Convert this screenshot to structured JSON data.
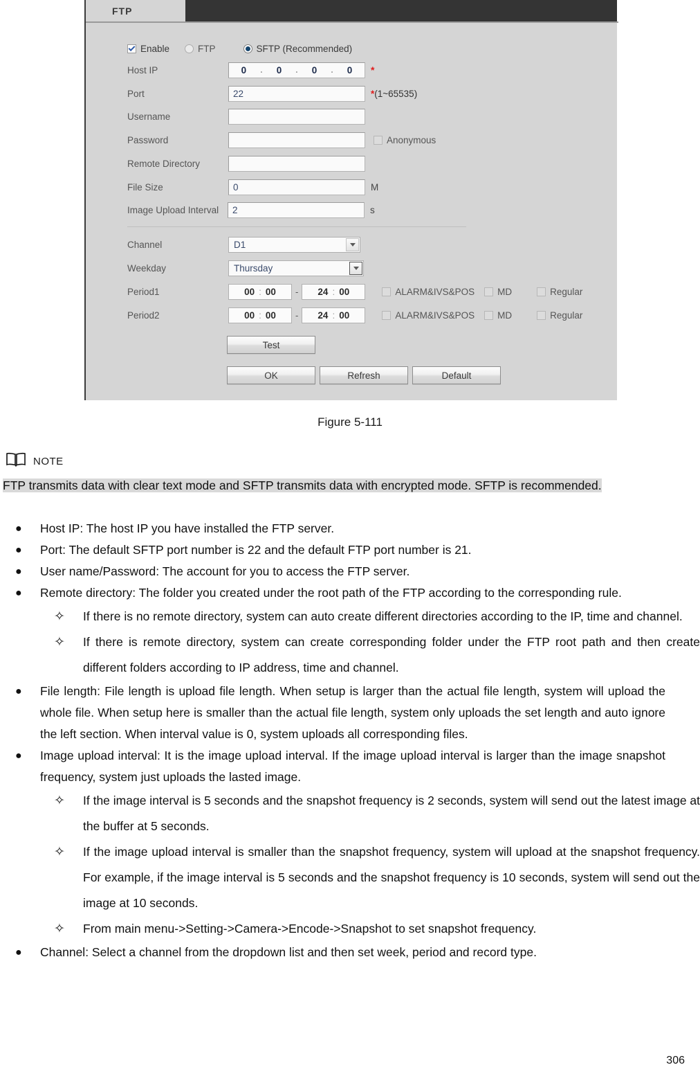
{
  "panel": {
    "tab_label": "FTP",
    "enable": {
      "label": "Enable",
      "checked": true
    },
    "protocol": {
      "ftp_label": "FTP",
      "sftp_label": "SFTP (Recommended)",
      "selected": "SFTP (Recommended)"
    },
    "fields": {
      "host_ip": {
        "label": "Host IP",
        "octets": [
          "0",
          "0",
          "0",
          "0"
        ],
        "required_mark": "*"
      },
      "port": {
        "label": "Port",
        "value": "22",
        "required_mark": "*",
        "range_hint": "(1~65535)"
      },
      "username": {
        "label": "Username",
        "value": "",
        "placeholder": ""
      },
      "password": {
        "label": "Password",
        "value": "",
        "placeholder": ""
      },
      "anonymous": {
        "label": "Anonymous",
        "checked": false
      },
      "remote_directory": {
        "label": "Remote Directory",
        "value": "",
        "placeholder": ""
      },
      "file_size": {
        "label": "File Size",
        "value": "0",
        "unit": "M"
      },
      "image_upload_interval": {
        "label": "Image Upload Interval",
        "value": "2",
        "unit": "s"
      },
      "channel": {
        "label": "Channel",
        "value": "D1"
      },
      "weekday": {
        "label": "Weekday",
        "value": "Thursday"
      }
    },
    "periods": [
      {
        "label": "Period1",
        "start_hour": "00",
        "start_min": "00",
        "end_hour": "24",
        "end_min": "00",
        "separator": "-",
        "types": [
          {
            "label": "ALARM&IVS&POS",
            "checked": false
          },
          {
            "label": "MD",
            "checked": false
          },
          {
            "label": "Regular",
            "checked": false
          }
        ]
      },
      {
        "label": "Period2",
        "start_hour": "00",
        "start_min": "00",
        "end_hour": "24",
        "end_min": "00",
        "separator": "-",
        "types": [
          {
            "label": "ALARM&IVS&POS",
            "checked": false
          },
          {
            "label": "MD",
            "checked": false
          },
          {
            "label": "Regular",
            "checked": false
          }
        ]
      }
    ],
    "buttons": {
      "test": "Test",
      "ok": "OK",
      "refresh": "Refresh",
      "default": "Default"
    },
    "colors": {
      "panel_bg": "#d5d5d5",
      "tabbar_bg": "#343434",
      "required_star": "#e01b1b",
      "radio_selected": "#15456e",
      "check_mark": "#2e5aa8"
    }
  },
  "doc": {
    "figure_caption": "Figure 5-111",
    "note_label": "NOTE",
    "note_text": "FTP transmits data with clear text mode and SFTP transmits data with encrypted mode. SFTP is recommended.",
    "bullets": [
      {
        "level": 1,
        "marker": "●",
        "text": "Host IP: The host IP you have installed the FTP server."
      },
      {
        "level": 1,
        "marker": "●",
        "text": "Port: The default SFTP port number is 22 and the default FTP port number is 21."
      },
      {
        "level": 1,
        "marker": "●",
        "text": "User name/Password: The account for you to access the FTP server."
      },
      {
        "level": 1,
        "marker": "●",
        "text": "Remote directory: The folder you created under the root path of the FTP according to the corresponding rule."
      },
      {
        "level": 2,
        "marker": "✧",
        "text": "If there is no remote directory, system can auto create different directories according to the IP, time and channel."
      },
      {
        "level": 2,
        "marker": "✧",
        "text": "If there is remote directory, system can create corresponding folder under the FTP root path and then create different folders according to IP address, time and channel."
      },
      {
        "level": 1,
        "marker": "●",
        "text": "File length: File length is upload file length. When setup is larger than the actual file length, system will upload the whole file. When setup here is smaller than the actual file length, system only uploads the set length and auto ignore the left section. When interval value is 0, system uploads all corresponding files."
      },
      {
        "level": 1,
        "marker": "●",
        "text": "Image upload interval: It is the image upload interval. If the image upload interval is larger than the image snapshot frequency, system just uploads the lasted image."
      },
      {
        "level": 2,
        "marker": "✧",
        "text": "If the image interval is 5 seconds and the snapshot frequency is 2 seconds, system will send out the latest image at the buffer at 5 seconds."
      },
      {
        "level": 2,
        "marker": "✧",
        "text": "If the image upload interval is smaller than the snapshot frequency, system will upload at the snapshot frequency. For example, if the image interval is 5 seconds and the snapshot frequency is 10 seconds, system will send out the image at 10 seconds."
      },
      {
        "level": 2,
        "marker": "✧",
        "text": "From main menu->Setting->Camera->Encode->Snapshot to set snapshot frequency."
      },
      {
        "level": 1,
        "marker": "●",
        "text": "Channel: Select a channel from the dropdown list and then set week, period and record type."
      }
    ],
    "page_number": "306"
  }
}
